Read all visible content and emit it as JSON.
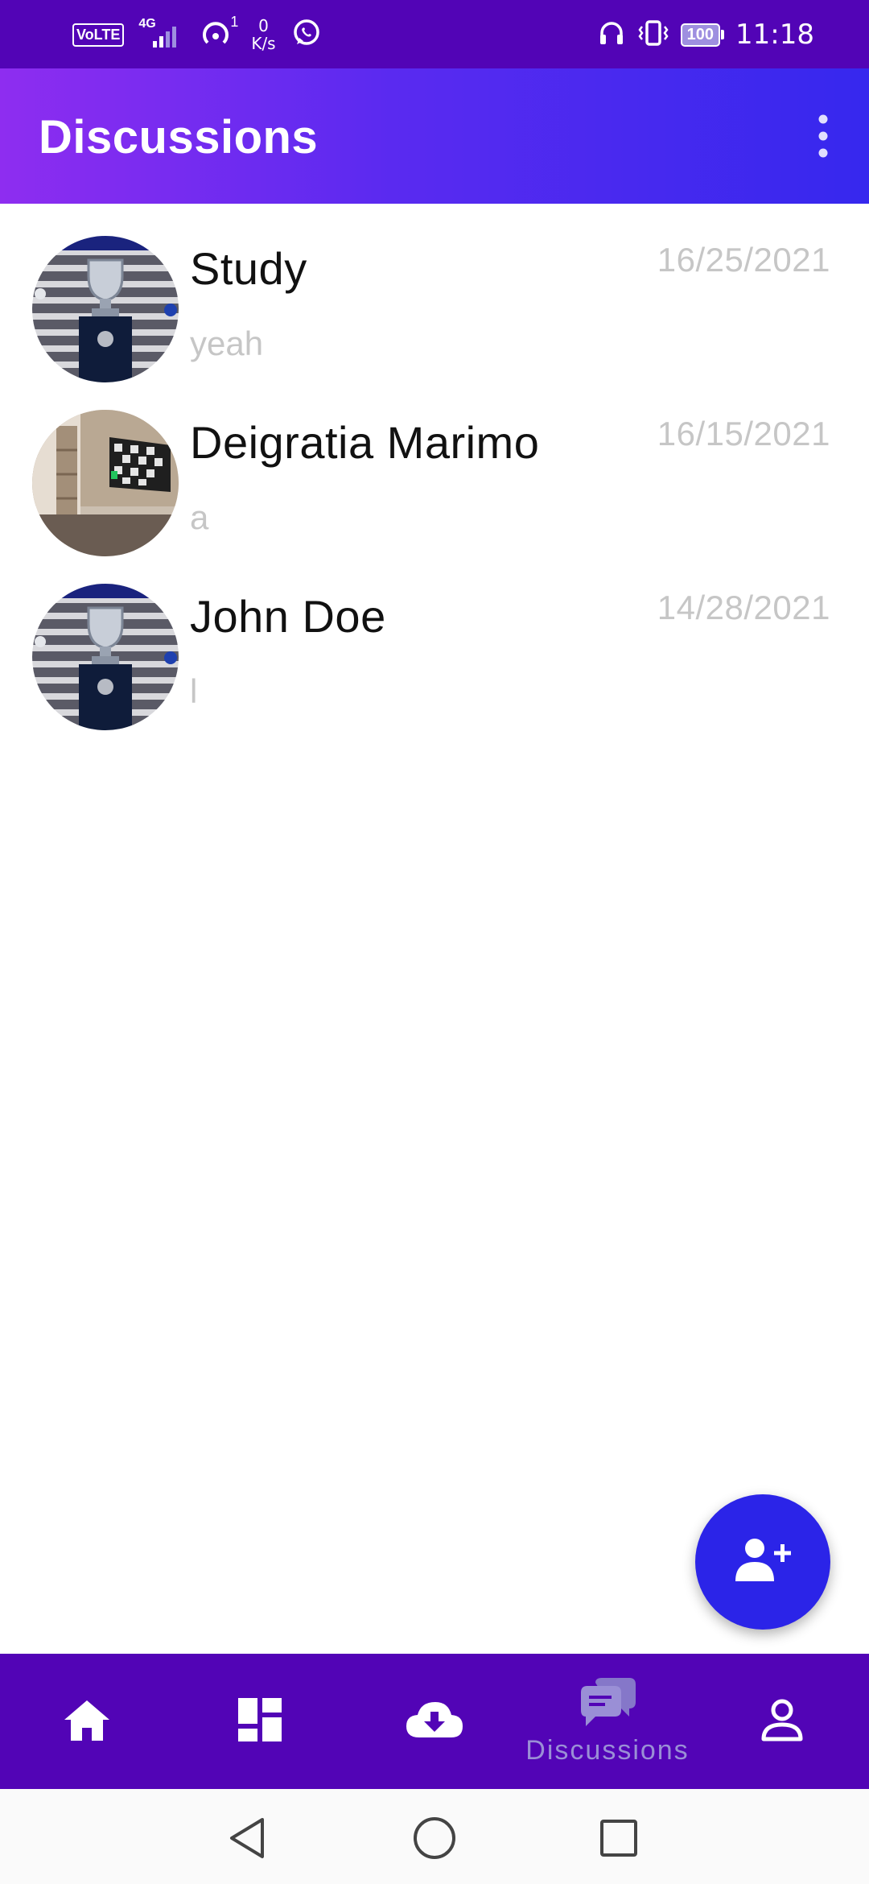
{
  "status_bar": {
    "volte": "VoLTE",
    "network": "4G",
    "hotspot_count": "1",
    "speed_value": "0",
    "speed_unit": "K/s",
    "battery": "100",
    "time": "11:18"
  },
  "app_bar": {
    "title": "Discussions",
    "menu_icon": "more-vert-icon"
  },
  "chats": [
    {
      "name": "Study",
      "date": "16/25/2021",
      "preview": "yeah",
      "avatar": "champions-league-trophy"
    },
    {
      "name": "Deigratia Marimo",
      "date": "16/15/2021",
      "preview": "a",
      "avatar": "room-with-tv"
    },
    {
      "name": "John Doe",
      "date": "14/28/2021",
      "preview": "l",
      "avatar": "champions-league-trophy"
    }
  ],
  "fab": {
    "icon": "add-user-icon"
  },
  "bottom_nav": {
    "items": [
      {
        "icon": "home-icon"
      },
      {
        "icon": "dashboard-icon"
      },
      {
        "icon": "cloud-download-icon"
      },
      {
        "icon": "chat-bubbles-icon",
        "label": "Discussions",
        "selected": true
      },
      {
        "icon": "person-icon"
      }
    ]
  },
  "colors": {
    "status_bar": "#5204B6",
    "appbar_start": "#8E2DF0",
    "appbar_end": "#3628EE",
    "fab": "#2B24E8",
    "bottom_nav": "#5204B6",
    "muted_text": "#C6C6C6"
  }
}
